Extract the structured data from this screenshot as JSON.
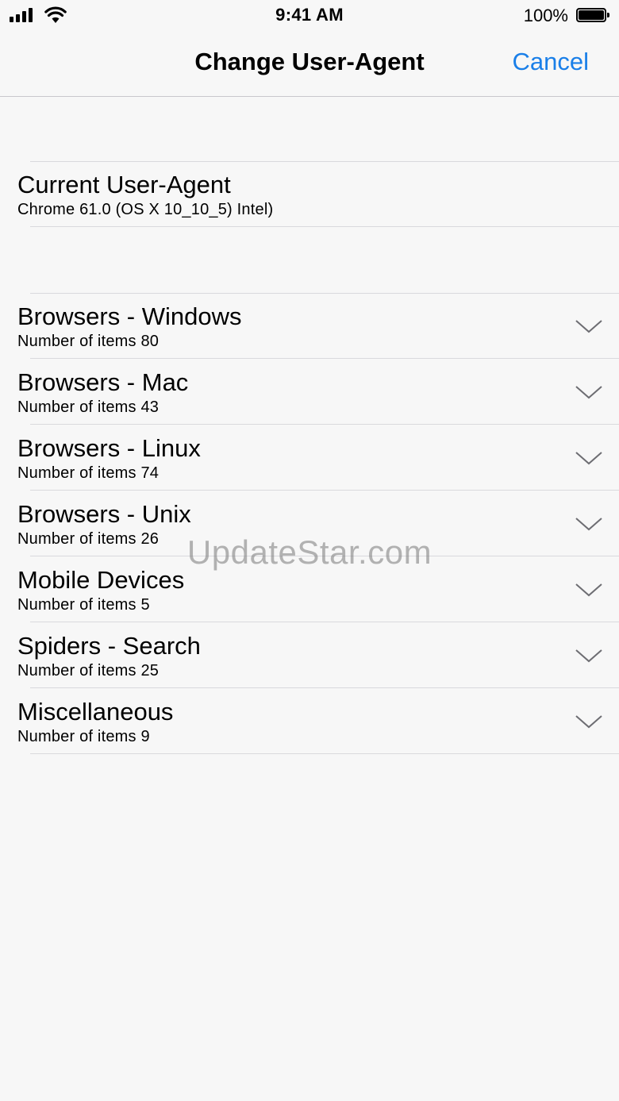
{
  "status_bar": {
    "time": "9:41 AM",
    "battery_percent": "100%",
    "signal_icon": "cellular-signal-icon",
    "wifi_icon": "wifi-icon",
    "battery_icon": "battery-icon"
  },
  "nav": {
    "title": "Change User-Agent",
    "cancel_label": "Cancel",
    "accent_color": "#1a7fe8"
  },
  "current": {
    "title": "Current User-Agent",
    "value": "Chrome 61.0 (OS X 10_10_5) Intel)"
  },
  "categories": [
    {
      "title": "Browsers - Windows",
      "subtitle": "Number of items 80"
    },
    {
      "title": "Browsers - Mac",
      "subtitle": "Number of items 43"
    },
    {
      "title": "Browsers - Linux",
      "subtitle": "Number of items 74"
    },
    {
      "title": "Browsers - Unix",
      "subtitle": "Number of items 26"
    },
    {
      "title": "Mobile Devices",
      "subtitle": "Number of items 5"
    },
    {
      "title": "Spiders - Search",
      "subtitle": "Number of items 25"
    },
    {
      "title": "Miscellaneous",
      "subtitle": "Number of items 9"
    }
  ],
  "watermark": "UpdateStar.com"
}
